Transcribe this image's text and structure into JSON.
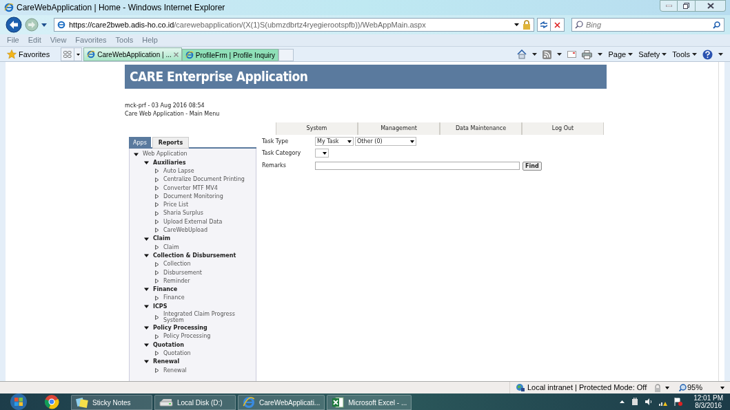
{
  "window": {
    "title": "CareWebApplication | Home - Windows Internet Explorer"
  },
  "address_bar": {
    "host": "https://care2bweb.adis-ho.co.id",
    "path": "/carewebapplication/(X(1)S(ubmzdbrtz4ryegierootspfb))/WebAppMain.aspx"
  },
  "search": {
    "placeholder": "Bing"
  },
  "menu_bar": [
    "File",
    "Edit",
    "View",
    "Favorites",
    "Tools",
    "Help"
  ],
  "favorites_label": "Favorites",
  "browser_tabs": [
    {
      "label": "CareWebApplication | ...",
      "selected": true
    },
    {
      "label": "ProfileFrm | Profile Inquiry",
      "selected": false
    }
  ],
  "command_bar": [
    "Page",
    "Safety",
    "Tools"
  ],
  "page": {
    "header": "CARE Enterprise Application",
    "user_line": "mck-prf - 03 Aug 2016 08:54",
    "subtitle": "Care Web Application - Main Menu",
    "top_menu": [
      "System",
      "Management",
      "Data Maintenance",
      "Log Out"
    ],
    "side_tabs": [
      {
        "label": "Apps",
        "selected": true
      },
      {
        "label": "Reports",
        "selected": false
      }
    ],
    "tree": [
      {
        "label": "Web Application",
        "expanded": true,
        "children": [
          {
            "label": "Auxiliaries",
            "expanded": true,
            "children": [
              {
                "label": "Auto Lapse",
                "expanded": false
              },
              {
                "label": "Centralize Document Printing",
                "expanded": false
              },
              {
                "label": "Converter MTF MV4",
                "expanded": false
              },
              {
                "label": "Document Monitoring",
                "expanded": false
              },
              {
                "label": "Price List",
                "expanded": false
              },
              {
                "label": "Sharia Surplus",
                "expanded": false
              },
              {
                "label": "Upload External Data",
                "expanded": false
              },
              {
                "label": "CareWebUpload",
                "expanded": false
              }
            ]
          },
          {
            "label": "Claim",
            "expanded": true,
            "children": [
              {
                "label": "Claim",
                "expanded": false
              }
            ]
          },
          {
            "label": "Collection & Disbursement",
            "expanded": true,
            "children": [
              {
                "label": "Collection",
                "expanded": false
              },
              {
                "label": "Disbursement",
                "expanded": false
              },
              {
                "label": "Reminder",
                "expanded": false
              }
            ]
          },
          {
            "label": "Finance",
            "expanded": true,
            "children": [
              {
                "label": "Finance",
                "expanded": false
              }
            ]
          },
          {
            "label": "ICPS",
            "expanded": true,
            "children": [
              {
                "label": "Integrated Claim Progress System",
                "expanded": false
              }
            ]
          },
          {
            "label": "Policy Processing",
            "expanded": true,
            "children": [
              {
                "label": "Policy Processing",
                "expanded": false
              }
            ]
          },
          {
            "label": "Quotation",
            "expanded": true,
            "children": [
              {
                "label": "Quotation",
                "expanded": false
              }
            ]
          },
          {
            "label": "Renewal",
            "expanded": true,
            "children": [
              {
                "label": "Renewal",
                "expanded": false
              }
            ]
          }
        ]
      }
    ],
    "form": {
      "task_type_label": "Task Type",
      "task_type": "My Task",
      "task_filter": "Other (0)",
      "task_category_label": "Task Category",
      "remarks_label": "Remarks",
      "find_button": "Find"
    }
  },
  "status_bar": {
    "zone": "Local intranet | Protected Mode: Off",
    "zoom": "95%"
  },
  "taskbar": {
    "items": [
      "Sticky Notes",
      "Local Disk (D:)",
      "CareWebApplicati...",
      "Microsoft Excel - ..."
    ],
    "time": "12:01 PM",
    "date": "8/3/2016"
  }
}
